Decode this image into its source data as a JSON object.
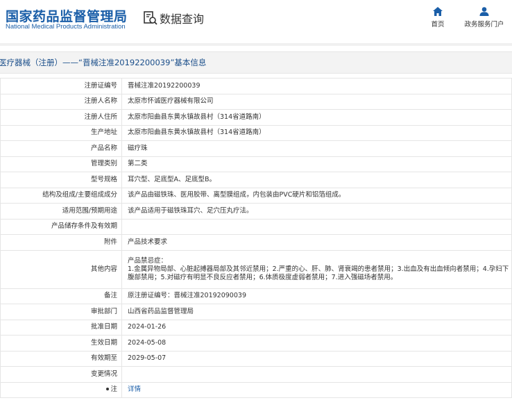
{
  "header": {
    "logo_cn": "国家药品监督管理局",
    "logo_en": "National Medical Products Administration",
    "query_title": "数据查询",
    "nav": [
      {
        "label": "首页",
        "icon": "home-icon"
      },
      {
        "label": "政务服务门户",
        "icon": "user-icon"
      }
    ]
  },
  "title": "医疗器械（注册）——“晋械注准20192200039”基本信息",
  "colors": {
    "brand": "#1a5ea8",
    "title": "#1a4e8a",
    "border": "#e5e5e5"
  },
  "rows": [
    {
      "label": "注册证编号",
      "value": "晋械注准20192200039"
    },
    {
      "label": "注册人名称",
      "value": "太原市怀诚医疗器械有限公司"
    },
    {
      "label": "注册人住所",
      "value": "太原市阳曲县东黄水镇故县村（314省道路南）"
    },
    {
      "label": "生产地址",
      "value": "太原市阳曲县东黄水镇故县村（314省道路南）"
    },
    {
      "label": "产品名称",
      "value": "磁疗珠"
    },
    {
      "label": "管理类别",
      "value": "第二类"
    },
    {
      "label": "型号规格",
      "value": "耳穴型、足底型A、足底型B。"
    },
    {
      "label": "结构及组成/主要组成成分",
      "value": "该产品由磁铁珠、医用胶带、离型膜组成，内包装由PVC硬片和铝箔组成。"
    },
    {
      "label": "适用范围/预期用途",
      "value": "该产品适用于磁铁珠耳穴、足穴压丸疗法。"
    },
    {
      "label": "产品储存条件及有效期",
      "value": ""
    },
    {
      "label": "附件",
      "value": "产品技术要求"
    },
    {
      "label": "其他内容",
      "value_lines": [
        "产品禁忌症：",
        "1.金属异物局部、心脏起搏器局部及其邻近禁用；2.严重的心、肝、肺、肾衰竭的患者禁用；3.出血及有出血倾向者禁用；4.孕妇下腹部禁用；5.对磁疗有明显不良反应者禁用；6.体质极度虚弱者禁用；7.进入强磁场者禁用。"
      ]
    },
    {
      "label": "备注",
      "value": "原注册证编号：晋械注准20192090039"
    },
    {
      "label": "审批部门",
      "value": "山西省药品监督管理局"
    },
    {
      "label": "批准日期",
      "value": "2024-01-26"
    },
    {
      "label": "生效日期",
      "value": "2024-05-08"
    },
    {
      "label": "有效期至",
      "value": "2029-05-07"
    },
    {
      "label": "变更情况",
      "value": ""
    },
    {
      "label": "注",
      "value": "详情",
      "is_link": true
    }
  ]
}
